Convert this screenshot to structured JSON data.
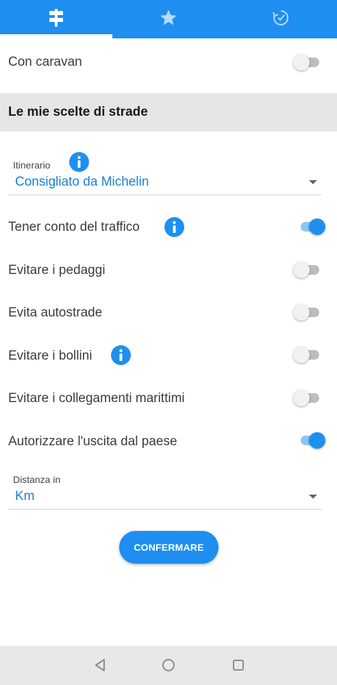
{
  "tabs": [
    {
      "icon": "signpost-icon",
      "active": true
    },
    {
      "icon": "star-icon",
      "active": false
    },
    {
      "icon": "history-icon",
      "active": false
    }
  ],
  "caravan": {
    "label": "Con caravan",
    "enabled": false
  },
  "section": {
    "title": "Le mie scelte di strade"
  },
  "itinerary": {
    "label": "Itinerario",
    "value": "Consigliato da Michelin"
  },
  "options": [
    {
      "label": "Tener conto del traffico",
      "enabled": true,
      "info": true
    },
    {
      "label": "Evitare i pedaggi",
      "enabled": false,
      "info": false
    },
    {
      "label": "Evita autostrade",
      "enabled": false,
      "info": false
    },
    {
      "label": "Evitare i bollini",
      "enabled": false,
      "info": true
    },
    {
      "label": "Evitare i collegamenti marittimi",
      "enabled": false,
      "info": false
    },
    {
      "label": "Autorizzare l'uscita dal paese",
      "enabled": true,
      "info": false
    }
  ],
  "distance": {
    "label": "Distanza in",
    "value": "Km"
  },
  "confirm_label": "CONFERMARE",
  "colors": {
    "accent": "#1e8ff0",
    "section_bg": "#e6e6e6",
    "link": "#1b7fd0"
  }
}
